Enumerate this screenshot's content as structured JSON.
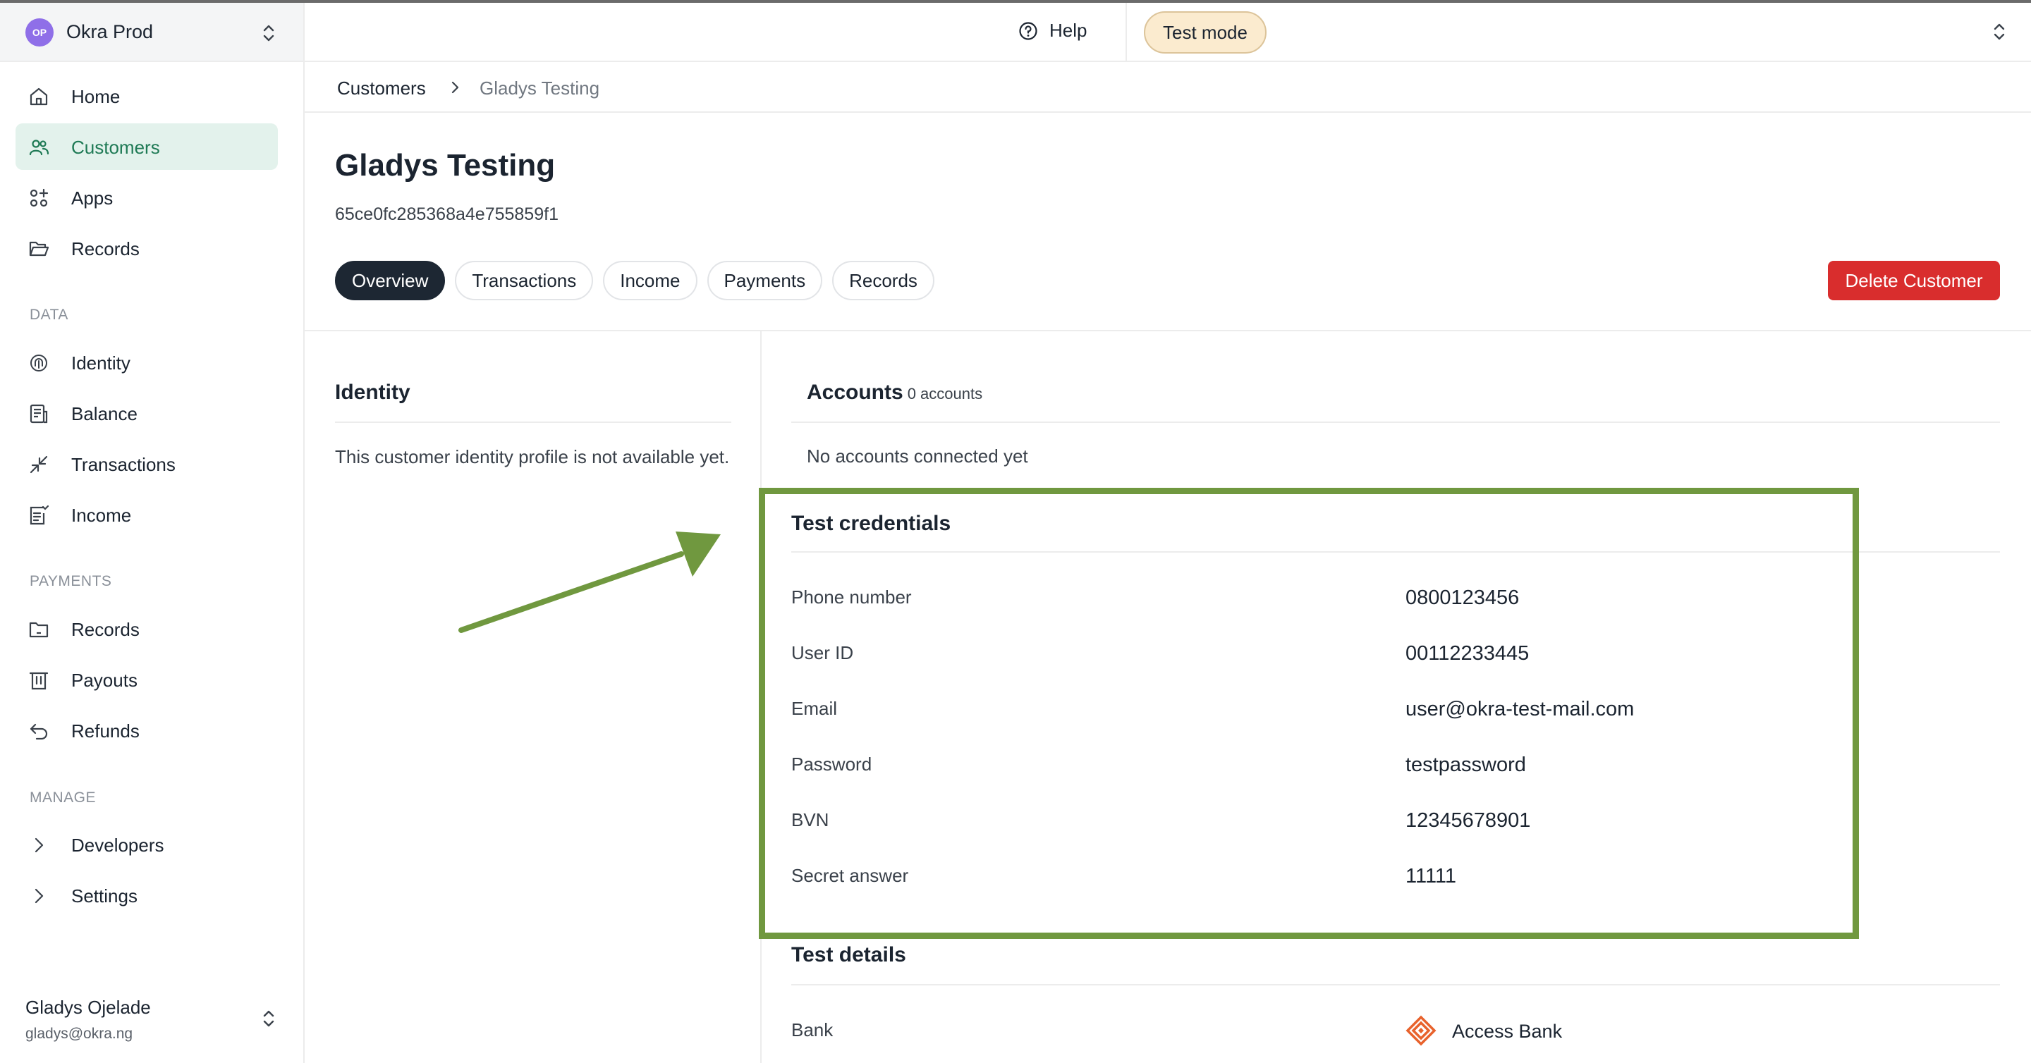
{
  "org": {
    "initials": "OP",
    "name": "Okra Prod"
  },
  "sidebar": {
    "main": [
      {
        "label": "Home",
        "icon": "home-icon"
      },
      {
        "label": "Customers",
        "icon": "users-icon",
        "active": true
      },
      {
        "label": "Apps",
        "icon": "apps-icon"
      },
      {
        "label": "Records",
        "icon": "folder-open-icon"
      }
    ],
    "data_label": "DATA",
    "data": [
      {
        "label": "Identity",
        "icon": "fingerprint-icon"
      },
      {
        "label": "Balance",
        "icon": "balance-icon"
      },
      {
        "label": "Transactions",
        "icon": "transactions-icon"
      },
      {
        "label": "Income",
        "icon": "income-icon"
      }
    ],
    "payments_label": "PAYMENTS",
    "payments": [
      {
        "label": "Records",
        "icon": "folder-icon"
      },
      {
        "label": "Payouts",
        "icon": "payouts-icon"
      },
      {
        "label": "Refunds",
        "icon": "refund-icon"
      }
    ],
    "manage_label": "MANAGE",
    "manage": [
      {
        "label": "Developers",
        "icon": "chevron-right-icon"
      },
      {
        "label": "Settings",
        "icon": "chevron-right-icon"
      }
    ],
    "user": {
      "name": "Gladys Ojelade",
      "email": "gladys@okra.ng"
    }
  },
  "header": {
    "help": "Help",
    "mode": "Test mode"
  },
  "breadcrumb": {
    "parent": "Customers",
    "current": "Gladys Testing"
  },
  "customer": {
    "name": "Gladys Testing",
    "id": "65ce0fc285368a4e755859f1",
    "tabs": [
      "Overview",
      "Transactions",
      "Income",
      "Payments",
      "Records"
    ],
    "active_tab": "Overview",
    "delete_label": "Delete Customer"
  },
  "identity": {
    "title": "Identity",
    "empty_text": "This customer identity profile is not available yet."
  },
  "accounts": {
    "title": "Accounts",
    "count": "0 accounts",
    "empty_text": "No accounts connected yet"
  },
  "test_credentials": {
    "title": "Test credentials",
    "rows": [
      {
        "label": "Phone number",
        "value": "0800123456"
      },
      {
        "label": "User ID",
        "value": "00112233445"
      },
      {
        "label": "Email",
        "value": "user@okra-test-mail.com"
      },
      {
        "label": "Password",
        "value": "testpassword"
      },
      {
        "label": "BVN",
        "value": "12345678901"
      },
      {
        "label": "Secret answer",
        "value": "11111"
      }
    ]
  },
  "test_details": {
    "title": "Test details",
    "bank_label": "Bank",
    "bank_name": "Access Bank"
  },
  "colors": {
    "accent_green": "#1f7a55",
    "active_bg": "#e3f2ec",
    "delete_red": "#d92d2d",
    "test_mode_bg": "#fbebcf",
    "annotation_green": "#70983f"
  }
}
